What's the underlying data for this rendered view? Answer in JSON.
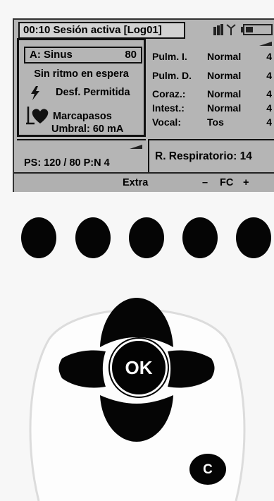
{
  "screen": {
    "title": "00:10 Sesión activa [Log01]",
    "rhythm": {
      "label": "A: Sinus",
      "value": "80"
    },
    "rhythm_status": "Sin ritmo en espera",
    "defib": "Desf. Permitida",
    "pacer": {
      "label": "Marcapasos",
      "threshold": "Umbral: 60 mA"
    },
    "sounds": [
      {
        "name": "Pulm. I.",
        "value": "Normal",
        "level": "4"
      },
      {
        "name": "Pulm. D.",
        "value": "Normal",
        "level": "4"
      },
      {
        "name": "Coraz.:",
        "value": "Normal",
        "level": "4"
      },
      {
        "name": "Intest.:",
        "value": "Normal",
        "level": "4"
      },
      {
        "name": "Vocal:",
        "value": "Tos",
        "level": "4"
      }
    ],
    "blood_pressure": "PS: 120 / 80 P:N 4",
    "resp_rate": "R. Respiratorio: 14",
    "softkeys": {
      "extra": "Extra",
      "minus": "–",
      "fc": "FC",
      "plus": "+"
    }
  },
  "hardware": {
    "ok_label": "OK",
    "c_label": "C"
  },
  "icons": {
    "battery": "battery-icon",
    "signal": "signal-bars-icon",
    "antenna": "antenna-icon",
    "defib": "lightning-bolt-icon",
    "pacer": "heart-pacer-icon"
  },
  "colors": {
    "lcd_background": "#b5b5b5",
    "button": "#050505"
  }
}
